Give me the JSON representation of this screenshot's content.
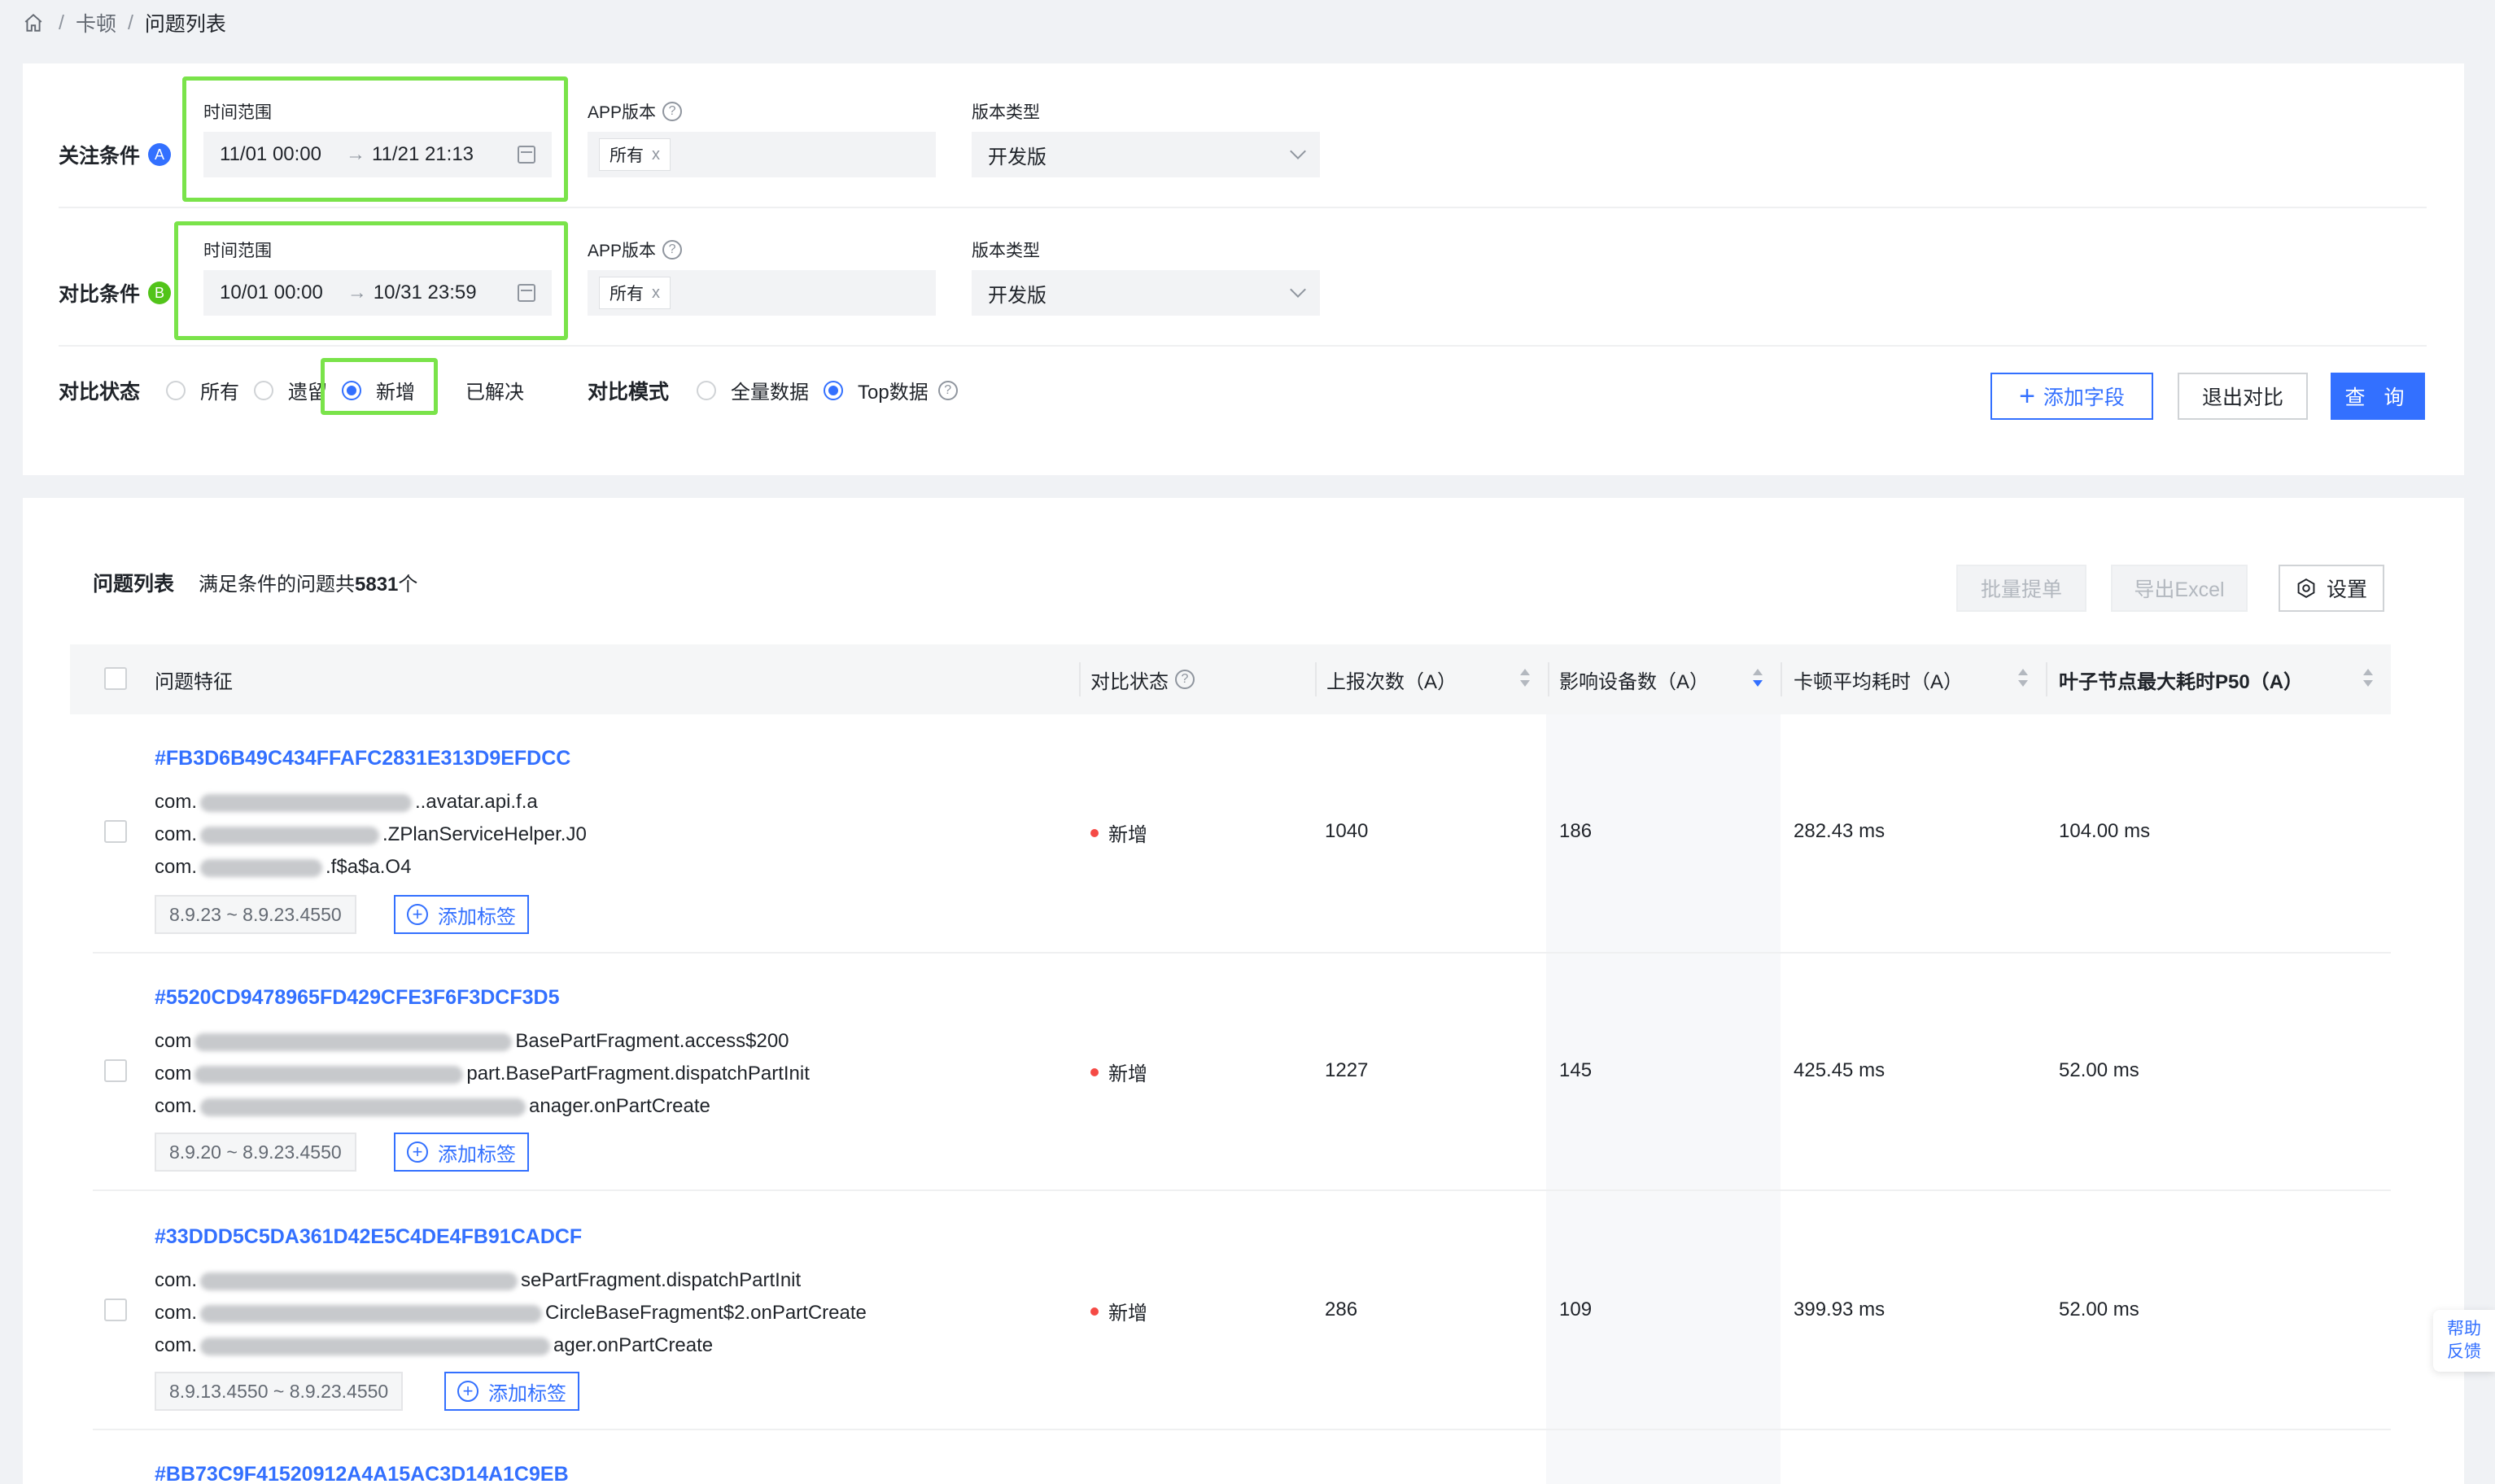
{
  "breadcrumb": {
    "sep": "/",
    "items": [
      "卡顿",
      "问题列表"
    ]
  },
  "focus": {
    "label": "关注条件",
    "badge": "A",
    "time_label": "时间范围",
    "time_start": "11/01 00:00",
    "time_end": "11/21 21:13",
    "app_label": "APP版本",
    "app_tag": "所有",
    "tag_close": "x",
    "vtype_label": "版本类型",
    "vtype_value": "开发版"
  },
  "compare": {
    "label": "对比条件",
    "badge": "B",
    "time_label": "时间范围",
    "time_start": "10/01 00:00",
    "time_end": "10/31 23:59",
    "app_label": "APP版本",
    "app_tag": "所有",
    "tag_close": "x",
    "vtype_label": "版本类型",
    "vtype_value": "开发版"
  },
  "arrow": "→",
  "state": {
    "label": "对比状态",
    "options": [
      "所有",
      "遗留",
      "新增",
      "已解决"
    ],
    "selected": "新增"
  },
  "mode": {
    "label": "对比模式",
    "options": [
      "全量数据",
      "Top数据"
    ],
    "selected": "Top数据"
  },
  "buttons": {
    "add_field": "添加字段",
    "exit_compare": "退出对比",
    "query": "查 询",
    "batch": "批量提单",
    "export": "导出Excel",
    "settings": "设置"
  },
  "list": {
    "title": "问题列表",
    "summary_prefix": "满足条件的问题共",
    "count": "5831",
    "summary_suffix": "个"
  },
  "columns": [
    "问题特征",
    "对比状态",
    "上报次数（A）",
    "影响设备数（A）",
    "卡顿平均耗时（A）",
    "叶子节点最大耗时P50（A）"
  ],
  "rows": [
    {
      "id": "#FB3D6B49C434FFAFC2831E313D9EFDCC",
      "lines": [
        [
          "com.",
          "..avatar.api.f.a"
        ],
        [
          "com.",
          ".ZPlanServiceHelper.J0"
        ],
        [
          "com.",
          ".f$a$a.O4"
        ]
      ],
      "version": "8.9.23 ~ 8.9.23.4550",
      "add_tag": "添加标签",
      "status": "新增",
      "reports": "1040",
      "devices": "186",
      "avg": "282.43 ms",
      "p50": "104.00 ms"
    },
    {
      "id": "#5520CD9478965FD429CFE3F6F3DCF3D5",
      "lines": [
        [
          "com",
          "BasePartFragment.access$200"
        ],
        [
          "com",
          "part.BasePartFragment.dispatchPartInit"
        ],
        [
          "com.",
          "anager.onPartCreate"
        ]
      ],
      "version": "8.9.20 ~ 8.9.23.4550",
      "add_tag": "添加标签",
      "status": "新增",
      "reports": "1227",
      "devices": "145",
      "avg": "425.45 ms",
      "p50": "52.00 ms"
    },
    {
      "id": "#33DDD5C5DA361D42E5C4DE4FB91CADCF",
      "lines": [
        [
          "com.",
          "sePartFragment.dispatchPartInit"
        ],
        [
          "com.",
          "CircleBaseFragment$2.onPartCreate"
        ],
        [
          "com.",
          "ager.onPartCreate"
        ]
      ],
      "version": "8.9.13.4550 ~ 8.9.23.4550",
      "add_tag": "添加标签",
      "status": "新增",
      "reports": "286",
      "devices": "109",
      "avg": "399.93 ms",
      "p50": "52.00 ms"
    }
  ],
  "partial_row_id": "#BB73C9F41520912A4A15AC3D14A1C9EB",
  "help": {
    "line1": "帮助",
    "line2": "反馈"
  }
}
